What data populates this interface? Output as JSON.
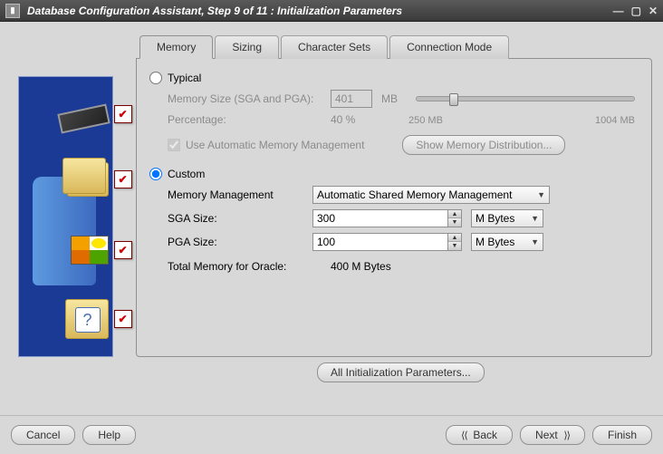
{
  "window": {
    "title": "Database Configuration Assistant, Step 9 of 11 : Initialization Parameters"
  },
  "tabs": {
    "memory": "Memory",
    "sizing": "Sizing",
    "charsets": "Character Sets",
    "connmode": "Connection Mode"
  },
  "typical": {
    "label": "Typical",
    "memory_size_label": "Memory Size (SGA and PGA):",
    "memory_size_value": "401",
    "memory_size_unit": "MB",
    "percentage_label": "Percentage:",
    "percentage_value": "40 %",
    "slider_min_label": "250 MB",
    "slider_max_label": "1004 MB",
    "auto_mem_label": "Use Automatic Memory Management",
    "auto_mem_checked": true,
    "show_dist_button": "Show Memory Distribution..."
  },
  "custom": {
    "label": "Custom",
    "mm_label": "Memory Management",
    "mm_value": "Automatic Shared Memory Management",
    "sga_label": "SGA Size:",
    "sga_value": "300",
    "sga_unit": "M Bytes",
    "pga_label": "PGA Size:",
    "pga_value": "100",
    "pga_unit": "M Bytes",
    "total_label": "Total Memory for Oracle:",
    "total_value": "400 M Bytes"
  },
  "buttons": {
    "all_params": "All Initialization Parameters...",
    "cancel": "Cancel",
    "help": "Help",
    "back": "Back",
    "next": "Next",
    "finish": "Finish"
  }
}
